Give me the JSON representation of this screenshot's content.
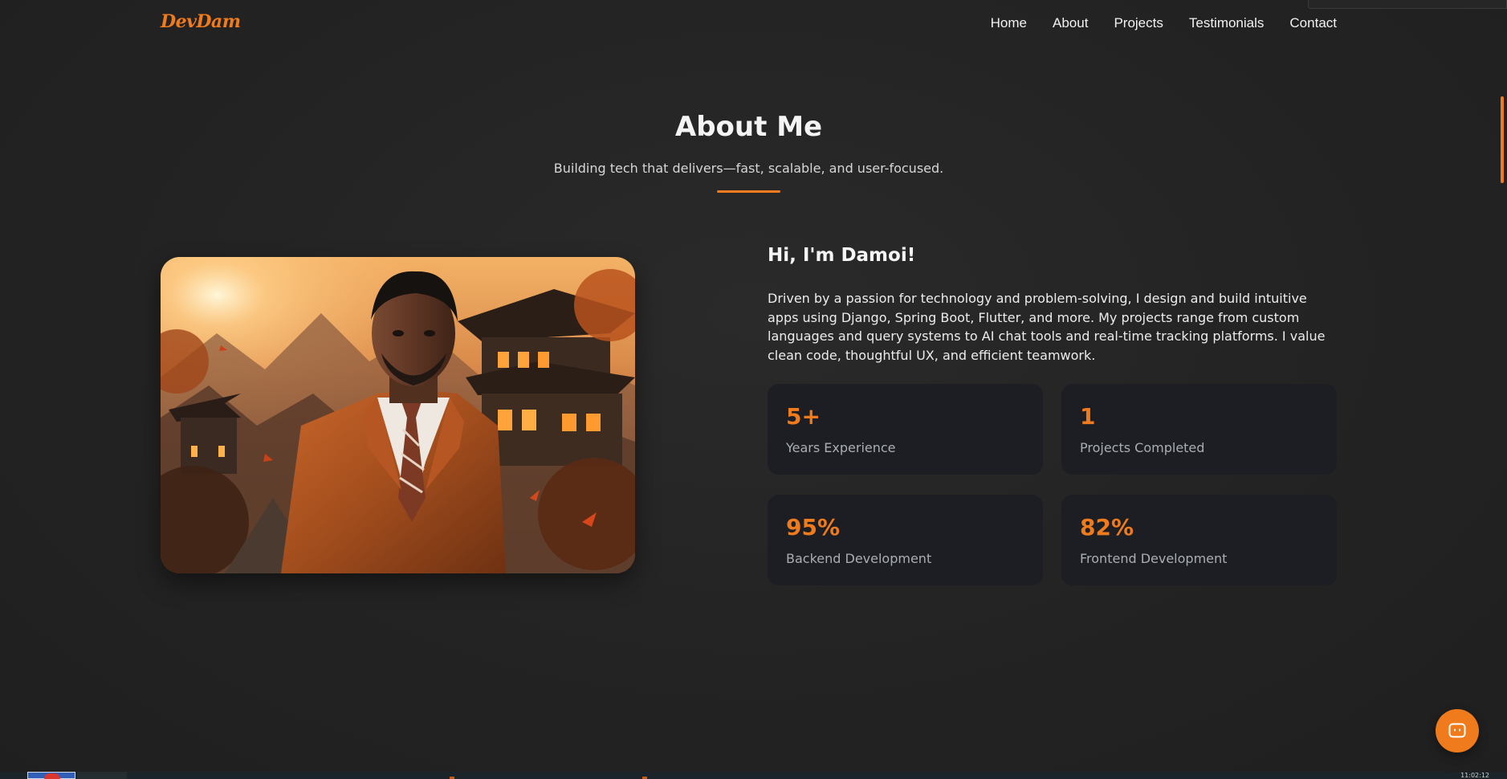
{
  "brand": {
    "logo_text": "DevDam",
    "accent_color": "#f07b1c",
    "background_color": "#232323",
    "card_color": "#1c1e23"
  },
  "nav": {
    "items": [
      {
        "label": "Home"
      },
      {
        "label": "About"
      },
      {
        "label": "Projects"
      },
      {
        "label": "Testimonials"
      },
      {
        "label": "Contact"
      }
    ]
  },
  "about": {
    "title": "About Me",
    "subtitle": "Building tech that delivers—fast, scalable, and user-focused.",
    "greeting": "Hi, I'm Damoi!",
    "description": "Driven by a passion for technology and problem-solving, I design and build intuitive apps using Django, Spring Boot, Flutter, and more. My projects range from custom languages and query systems to AI chat tools and real-time tracking platforms. I value clean code, thoughtful UX, and efficient teamwork.",
    "portrait_icon": "portrait-photo",
    "stats": [
      {
        "value": "5+",
        "label": "Years Experience"
      },
      {
        "value": "1",
        "label": "Projects Completed"
      },
      {
        "value": "95%",
        "label": "Backend Development"
      },
      {
        "value": "82%",
        "label": "Frontend Development"
      }
    ]
  },
  "chat_widget": {
    "icon": "chat-bot-icon"
  },
  "taskbar": {
    "clock": "11:02:12"
  }
}
